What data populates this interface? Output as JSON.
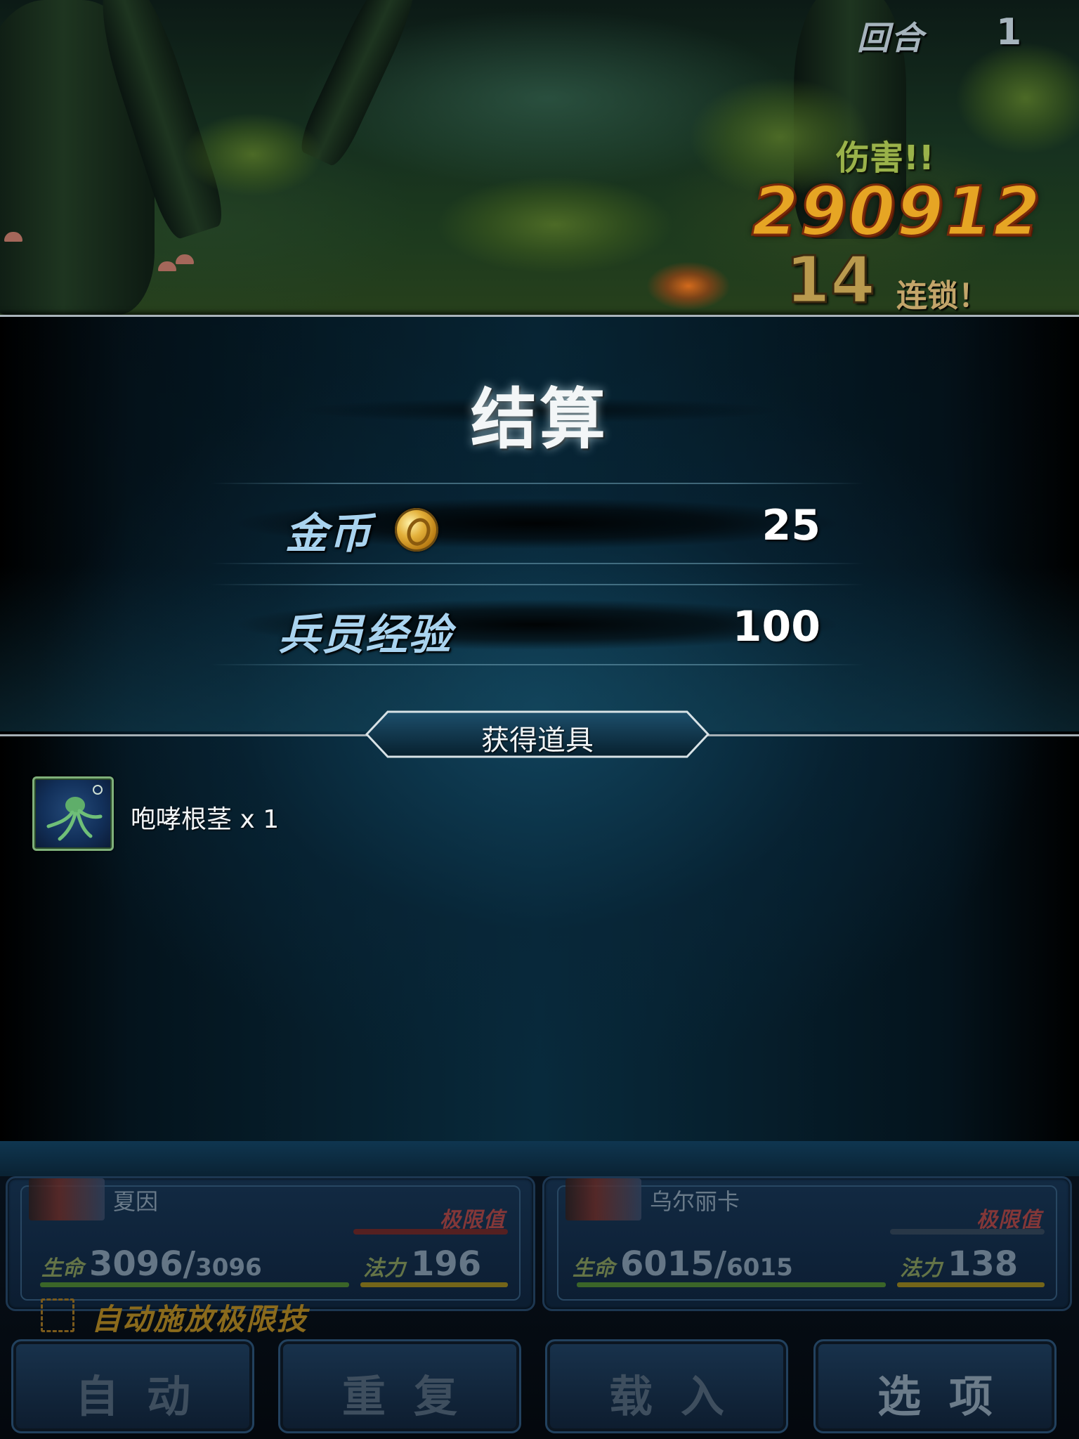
{
  "hud_top": {
    "round_label": "回合",
    "round_value": "1",
    "damage_label": "伤害!!",
    "damage_value": "290912",
    "chain_count": "14",
    "chain_label": "连锁！"
  },
  "results": {
    "title": "结算",
    "gold_label": "金币",
    "gold_value": "25",
    "exp_label": "兵员经验",
    "exp_value": "100",
    "items_banner": "获得道具",
    "items": [
      {
        "label": "咆哮根茎 x 1",
        "icon": "roaring-root-icon"
      }
    ]
  },
  "party": [
    {
      "name": "夏因",
      "limit_label": "极限值",
      "hp_label": "生命",
      "hp": "3096",
      "hp_max": "3096",
      "mp_label": "法力",
      "mp": "196"
    },
    {
      "name": "乌尔丽卡",
      "limit_label": "极限值",
      "hp_label": "生命",
      "hp": "6015",
      "hp_max": "6015",
      "mp_label": "法力",
      "mp": "138"
    }
  ],
  "auto_limit_label": "自动施放极限技",
  "buttons": {
    "auto": "自动",
    "repeat": "重复",
    "load": "载入",
    "options": "选项"
  },
  "colors": {
    "damage": "#e6a524",
    "title": "#f3f6f7",
    "label": "#a9d3ef"
  }
}
